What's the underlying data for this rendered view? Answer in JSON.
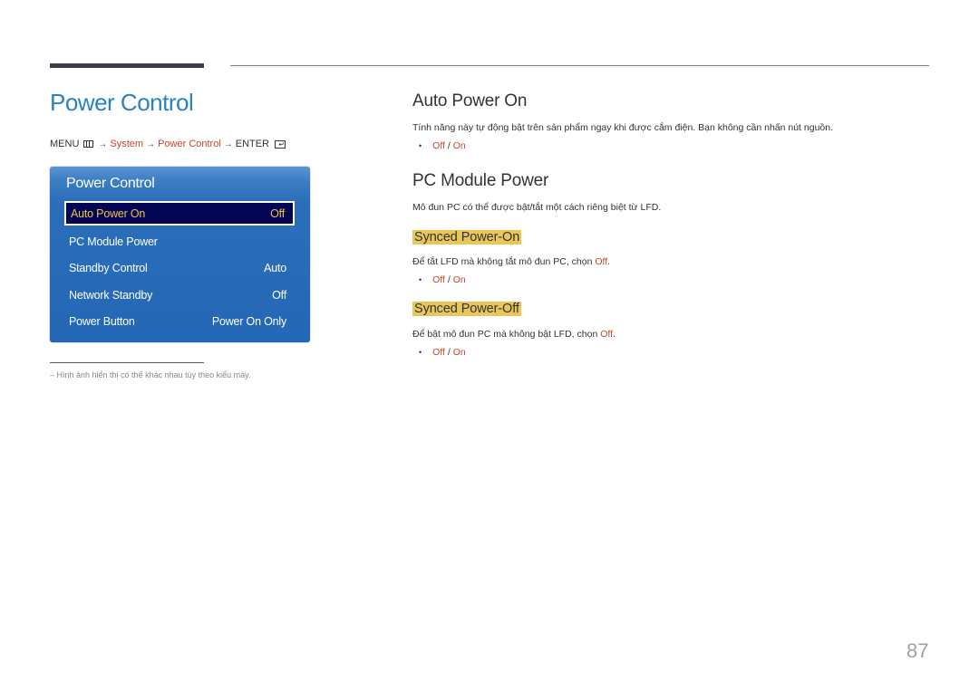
{
  "page_title": "Power Control",
  "breadcrumb": {
    "menu": "MENU",
    "menu_icon": "menu-grid-icon",
    "arrow": "→",
    "system": "System",
    "power_control": "Power Control",
    "enter": "ENTER",
    "enter_icon": "enter-icon"
  },
  "osd": {
    "title": "Power Control",
    "items": [
      {
        "label": "Auto Power On",
        "value": "Off",
        "selected": true
      },
      {
        "label": "PC Module Power",
        "value": ""
      },
      {
        "label": "Standby Control",
        "value": "Auto"
      },
      {
        "label": "Network Standby",
        "value": "Off"
      },
      {
        "label": "Power Button",
        "value": "Power On Only"
      }
    ]
  },
  "footnote": "–  Hình ảnh hiển thị có thể khác nhau tùy theo kiểu máy.",
  "sections": {
    "auto_power_on": {
      "heading": "Auto Power On",
      "desc": "Tính năng này tự động bật trên sản phẩm ngay khi được cắm điện. Bạn không cần nhấn nút nguồn.",
      "bullet": "•",
      "opt_off": "Off",
      "sep": " / ",
      "opt_on": "On"
    },
    "pc_module_power": {
      "heading": "PC Module Power",
      "desc": "Mô đun PC có thể được bật/tắt một cách riêng biệt từ LFD."
    },
    "synced_on": {
      "heading": "Synced Power-On",
      "desc_pre": "Để tắt LFD mà không tắt mô đun PC, chọn ",
      "desc_hl": "Off",
      "desc_post": ".",
      "bullet": "•",
      "opt_off": "Off",
      "sep": " / ",
      "opt_on": "On"
    },
    "synced_off": {
      "heading": "Synced Power-Off",
      "desc_pre": "Để bật mô đun PC mà không bật LFD, chọn ",
      "desc_hl": "Off",
      "desc_post": ".",
      "bullet": "•",
      "opt_off": "Off",
      "sep": " / ",
      "opt_on": "On"
    }
  },
  "colors": {
    "title_blue": "#2a82c6",
    "highlight_red": "#c8472b",
    "tag_yellow": "#e8c65a",
    "osd_blue": "#2467b5",
    "osd_selected_bg": "#030454",
    "osd_selected_text": "#f0c24a"
  },
  "page_number": "87"
}
